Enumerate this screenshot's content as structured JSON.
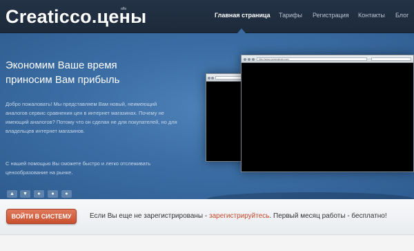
{
  "header": {
    "logo": "Creaticco.цены",
    "logo_beta": "alfa",
    "nav": [
      {
        "label": "Главная страница",
        "active": true
      },
      {
        "label": "Тарифы",
        "active": false
      },
      {
        "label": "Регистрация",
        "active": false
      },
      {
        "label": "Контакты",
        "active": false
      },
      {
        "label": "Блог",
        "active": false
      }
    ]
  },
  "hero": {
    "title_line1": "Экономим Ваше время",
    "title_line2": "приносим Вам прибыль",
    "paragraph1": "Добро пожаловать! Мы представляем Вам новый, неимеющий аналогов сервис сравнения цен в интернет магазинах. Почему не имеющий аналогов? Потому что он сделан не для покупателей, но для владельцев интернет магазинов.",
    "paragraph2": "С нашей помощью Вы сможете быстро и легко отслеживать ценообразование на рынке.",
    "browser_url": "http://www.screenshots.com",
    "slider_controls": [
      "▲",
      "▼",
      "●",
      "●",
      "●"
    ]
  },
  "cta": {
    "login_button": "ВОЙТИ В СИСТЕМУ",
    "text_before": "Если Вы еще не зарегистрированы - ",
    "register_link": "зарегистрируйтесь",
    "text_after": ". Первый месяц работы - бесплатно!"
  },
  "colors": {
    "header_bg": "#1f2d3f",
    "hero_bg": "#3c6ea5",
    "accent": "#c54a2c"
  }
}
